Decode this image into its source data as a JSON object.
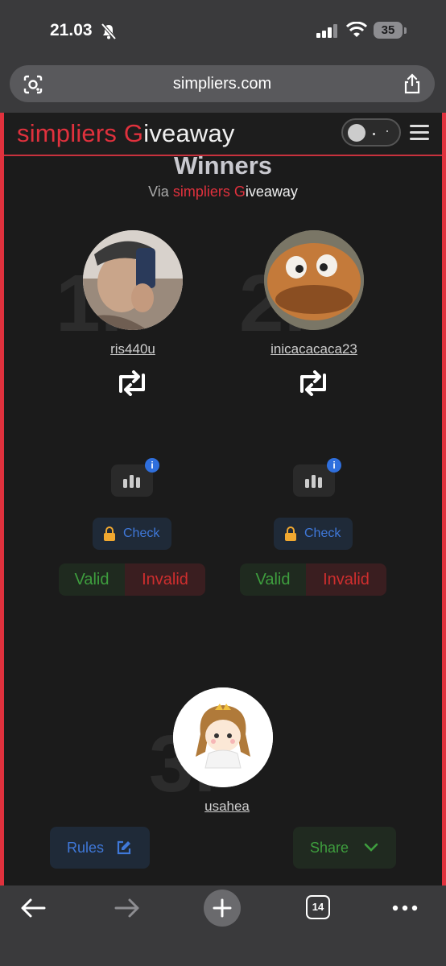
{
  "status": {
    "time": "21.03",
    "battery": "35"
  },
  "browser": {
    "url": "simpliers.com",
    "tab_count": "14"
  },
  "nav": {
    "brand_s": "simpliers ",
    "brand_g": "G",
    "brand_i": "i",
    "brand_rest": "veaway"
  },
  "page": {
    "title": "Winners",
    "via_prefix": "Via ",
    "via_brand": "simpliers G",
    "via_i": "i",
    "via_rest": "veaway"
  },
  "winners": [
    {
      "rank": "1.",
      "username": "ris440u",
      "check_label": "Check",
      "valid_label": "Valid",
      "invalid_label": "Invalid",
      "info_badge": "i"
    },
    {
      "rank": "2.",
      "username": "inicacacaca23",
      "check_label": "Check",
      "valid_label": "Valid",
      "invalid_label": "Invalid",
      "info_badge": "i"
    },
    {
      "rank": "3.",
      "username": "usahea"
    }
  ],
  "actions": {
    "rules_label": "Rules",
    "share_label": "Share"
  },
  "colors": {
    "brand_red": "#e0313d",
    "blue": "#3f78d9",
    "green": "#3e9e3e",
    "invalid_red": "#cf2e2e"
  }
}
